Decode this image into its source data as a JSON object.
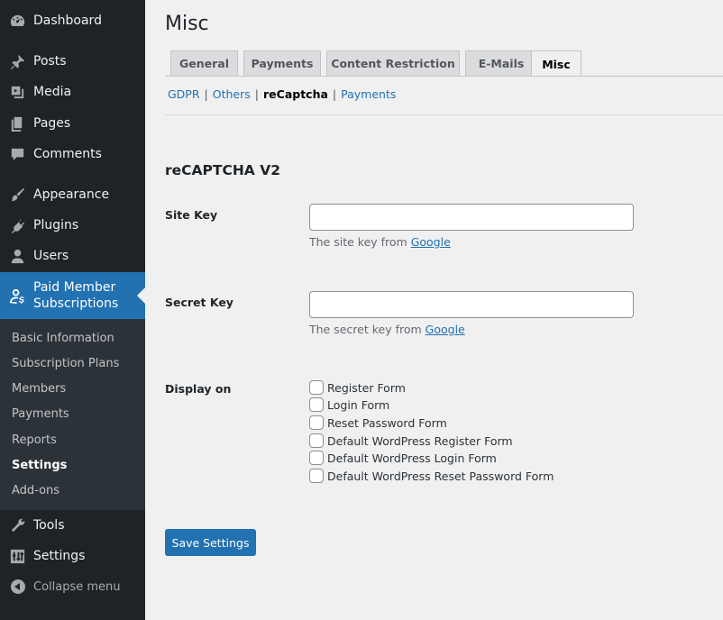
{
  "sidebar": {
    "items": [
      {
        "label": "Dashboard",
        "icon": "dashboard-icon"
      },
      {
        "label": "Posts",
        "icon": "pin-icon"
      },
      {
        "label": "Media",
        "icon": "media-icon"
      },
      {
        "label": "Pages",
        "icon": "pages-icon"
      },
      {
        "label": "Comments",
        "icon": "comments-icon"
      },
      {
        "label": "Appearance",
        "icon": "brush-icon"
      },
      {
        "label": "Plugins",
        "icon": "plugin-icon"
      },
      {
        "label": "Users",
        "icon": "users-icon"
      },
      {
        "label_line1": "Paid Member",
        "label_line2": "Subscriptions",
        "icon": "member-icon"
      },
      {
        "label": "Tools",
        "icon": "wrench-icon"
      },
      {
        "label": "Settings",
        "icon": "settings-icon"
      }
    ],
    "submenu": [
      "Basic Information",
      "Subscription Plans",
      "Members",
      "Payments",
      "Reports",
      "Settings",
      "Add-ons"
    ],
    "collapse": "Collapse menu"
  },
  "page": {
    "title": "Misc",
    "tabs": [
      "General",
      "Payments",
      "Content Restriction",
      "E-Mails",
      "Misc"
    ],
    "active_tab": "Misc",
    "subtabs": [
      "GDPR",
      "Others",
      "reCaptcha",
      "Payments"
    ],
    "active_subtab": "reCaptcha",
    "sep": "|"
  },
  "form": {
    "section_title": "reCAPTCHA V2",
    "site_key": {
      "label": "Site Key",
      "value": "",
      "desc_prefix": "The site key from ",
      "desc_link": "Google"
    },
    "secret_key": {
      "label": "Secret Key",
      "value": "",
      "desc_prefix": "The secret key from ",
      "desc_link": "Google"
    },
    "display_on": {
      "label": "Display on",
      "options": [
        "Register Form",
        "Login Form",
        "Reset Password Form",
        "Default WordPress Register Form",
        "Default WordPress Login Form",
        "Default WordPress Reset Password Form"
      ]
    },
    "save_label": "Save Settings"
  },
  "colors": {
    "sidebar_bg": "#1d2327",
    "submenu_bg": "#2c3338",
    "accent": "#2271b1",
    "content_bg": "#f0f0f1"
  }
}
